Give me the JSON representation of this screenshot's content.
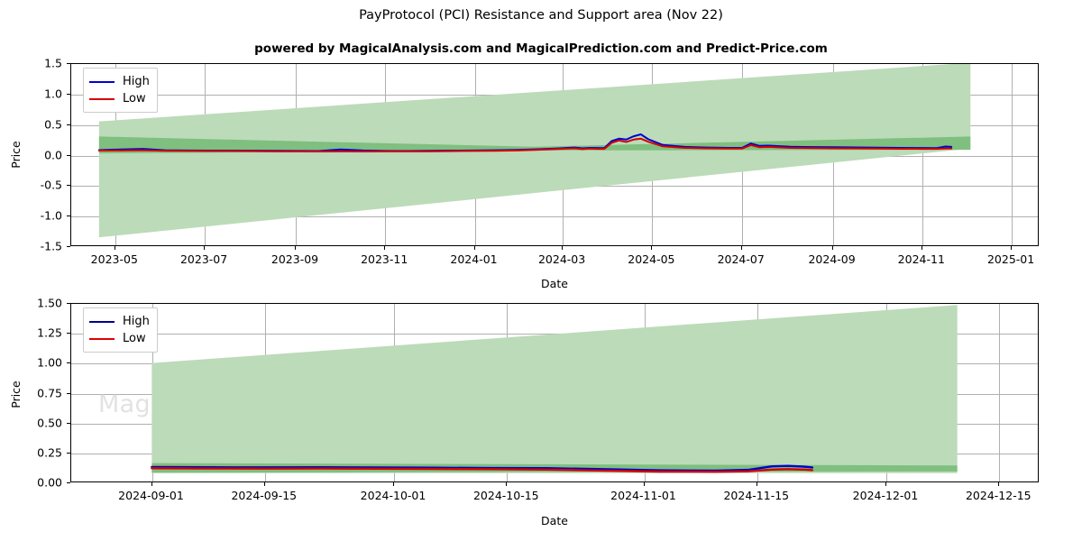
{
  "header": {
    "title": "PayProtocol (PCI) Resistance and Support area (Nov 22)",
    "subtitle": "powered by MagicalAnalysis.com and MagicalPrediction.com and Predict-Price.com"
  },
  "watermarks": {
    "analysis": "MagicalAnalysis.com",
    "prediction": "MagicalPrediction.com"
  },
  "colors": {
    "high_line": "#0000cd",
    "low_line": "#d40000",
    "band_outer": "#bcdbb9",
    "band_inner": "#7fbf7f",
    "grid": "#b0b0b0",
    "axis": "#000000"
  },
  "chart_data": [
    {
      "id": "upper",
      "type": "line",
      "title": "PayProtocol (PCI) Resistance and Support area (Nov 22)",
      "xlabel": "Date",
      "ylabel": "Price",
      "grid": true,
      "legend_position": "upper left",
      "xlim": [
        "2023-04-01",
        "2025-01-20"
      ],
      "ylim": [
        -1.5,
        1.5
      ],
      "xticks": [
        "2023-05",
        "2023-07",
        "2023-09",
        "2023-11",
        "2024-01",
        "2024-03",
        "2024-05",
        "2024-07",
        "2024-09",
        "2024-11",
        "2025-01"
      ],
      "yticks": [
        -1.5,
        -1.0,
        -0.5,
        0.0,
        0.5,
        1.0,
        1.5
      ],
      "series": [
        {
          "name": "High",
          "color": "#0000cd",
          "x": [
            "2023-04-20",
            "2023-05-05",
            "2023-05-20",
            "2023-06-04",
            "2023-06-19",
            "2023-07-04",
            "2023-07-19",
            "2023-08-03",
            "2023-08-18",
            "2023-09-02",
            "2023-09-17",
            "2023-10-02",
            "2023-10-17",
            "2023-11-01",
            "2023-11-16",
            "2023-12-01",
            "2023-12-16",
            "2023-12-31",
            "2024-01-15",
            "2024-01-30",
            "2024-02-14",
            "2024-02-29",
            "2024-03-10",
            "2024-03-15",
            "2024-03-20",
            "2024-03-25",
            "2024-03-30",
            "2024-04-04",
            "2024-04-09",
            "2024-04-14",
            "2024-04-19",
            "2024-04-24",
            "2024-04-29",
            "2024-05-09",
            "2024-05-24",
            "2024-06-08",
            "2024-06-23",
            "2024-07-02",
            "2024-07-08",
            "2024-07-14",
            "2024-07-20",
            "2024-08-04",
            "2024-08-19",
            "2024-09-03",
            "2024-09-18",
            "2024-10-03",
            "2024-10-18",
            "2024-11-02",
            "2024-11-12",
            "2024-11-18",
            "2024-11-22"
          ],
          "y": [
            0.075,
            0.085,
            0.095,
            0.072,
            0.07,
            0.068,
            0.067,
            0.065,
            0.063,
            0.062,
            0.06,
            0.086,
            0.07,
            0.062,
            0.061,
            0.063,
            0.066,
            0.07,
            0.072,
            0.078,
            0.088,
            0.105,
            0.118,
            0.105,
            0.112,
            0.11,
            0.108,
            0.225,
            0.265,
            0.25,
            0.305,
            0.335,
            0.255,
            0.16,
            0.128,
            0.118,
            0.112,
            0.112,
            0.185,
            0.145,
            0.15,
            0.13,
            0.125,
            0.122,
            0.12,
            0.115,
            0.112,
            0.11,
            0.108,
            0.135,
            0.128
          ]
        },
        {
          "name": "Low",
          "color": "#d40000",
          "x": [
            "2023-04-20",
            "2023-05-05",
            "2023-05-20",
            "2023-06-04",
            "2023-06-19",
            "2023-07-04",
            "2023-07-19",
            "2023-08-03",
            "2023-08-18",
            "2023-09-02",
            "2023-09-17",
            "2023-10-02",
            "2023-10-17",
            "2023-11-01",
            "2023-11-16",
            "2023-12-01",
            "2023-12-16",
            "2023-12-31",
            "2024-01-15",
            "2024-01-30",
            "2024-02-14",
            "2024-02-29",
            "2024-03-10",
            "2024-03-15",
            "2024-03-20",
            "2024-03-25",
            "2024-03-30",
            "2024-04-04",
            "2024-04-09",
            "2024-04-14",
            "2024-04-19",
            "2024-04-24",
            "2024-04-29",
            "2024-05-09",
            "2024-05-24",
            "2024-06-08",
            "2024-06-23",
            "2024-07-02",
            "2024-07-08",
            "2024-07-14",
            "2024-07-20",
            "2024-08-04",
            "2024-08-19",
            "2024-09-03",
            "2024-09-18",
            "2024-10-03",
            "2024-10-18",
            "2024-11-02",
            "2024-11-12",
            "2024-11-18",
            "2024-11-22"
          ],
          "y": [
            0.068,
            0.07,
            0.072,
            0.064,
            0.062,
            0.06,
            0.059,
            0.057,
            0.055,
            0.054,
            0.052,
            0.055,
            0.052,
            0.054,
            0.053,
            0.055,
            0.058,
            0.062,
            0.064,
            0.07,
            0.08,
            0.095,
            0.105,
            0.092,
            0.1,
            0.096,
            0.094,
            0.195,
            0.235,
            0.21,
            0.25,
            0.265,
            0.215,
            0.138,
            0.112,
            0.105,
            0.1,
            0.1,
            0.158,
            0.122,
            0.128,
            0.112,
            0.108,
            0.105,
            0.104,
            0.1,
            0.098,
            0.096,
            0.094,
            0.102,
            0.104
          ]
        }
      ],
      "bands": [
        {
          "name": "outer-resistance-support",
          "color": "#bcdbb9",
          "x_start": "2023-04-20",
          "x_end": "2024-12-05",
          "upper_start": 0.55,
          "upper_end": 1.52,
          "lower_start": -1.37,
          "lower_end": 0.1
        },
        {
          "name": "inner-resistance-support",
          "color": "#7fbf7f",
          "x_start": "2023-04-20",
          "x_end": "2024-12-05",
          "upper_start": 0.3,
          "upper_mid": 0.13,
          "upper_end": 0.3,
          "lower_start": 0.02,
          "lower_mid": 0.07,
          "lower_end": 0.08
        }
      ]
    },
    {
      "id": "lower",
      "type": "line",
      "xlabel": "Date",
      "ylabel": "Price",
      "grid": true,
      "legend_position": "upper left",
      "xlim": [
        "2024-08-22",
        "2024-12-20"
      ],
      "ylim": [
        0.0,
        1.5
      ],
      "xticks": [
        "2024-09-01",
        "2024-09-15",
        "2024-10-01",
        "2024-10-15",
        "2024-11-01",
        "2024-11-15",
        "2024-12-01",
        "2024-12-15"
      ],
      "yticks": [
        0.0,
        0.25,
        0.5,
        0.75,
        1.0,
        1.25,
        1.5
      ],
      "series": [
        {
          "name": "High",
          "color": "#0000cd",
          "x": [
            "2024-09-01",
            "2024-09-08",
            "2024-09-15",
            "2024-09-22",
            "2024-09-29",
            "2024-10-06",
            "2024-10-13",
            "2024-10-20",
            "2024-10-27",
            "2024-11-03",
            "2024-11-10",
            "2024-11-14",
            "2024-11-17",
            "2024-11-19",
            "2024-11-21",
            "2024-11-22"
          ],
          "y": [
            0.122,
            0.12,
            0.119,
            0.12,
            0.118,
            0.116,
            0.114,
            0.112,
            0.104,
            0.094,
            0.092,
            0.098,
            0.128,
            0.132,
            0.125,
            0.118
          ]
        },
        {
          "name": "Low",
          "color": "#d40000",
          "x": [
            "2024-09-01",
            "2024-09-08",
            "2024-09-15",
            "2024-09-22",
            "2024-09-29",
            "2024-10-06",
            "2024-10-13",
            "2024-10-20",
            "2024-10-27",
            "2024-11-03",
            "2024-11-10",
            "2024-11-14",
            "2024-11-17",
            "2024-11-19",
            "2024-11-21",
            "2024-11-22"
          ],
          "y": [
            0.112,
            0.11,
            0.109,
            0.11,
            0.108,
            0.106,
            0.104,
            0.1,
            0.092,
            0.084,
            0.082,
            0.086,
            0.1,
            0.104,
            0.1,
            0.096
          ]
        }
      ],
      "bands": [
        {
          "name": "outer-resistance-support",
          "color": "#bcdbb9",
          "x_start": "2024-09-01",
          "x_end": "2024-12-10",
          "upper_start": 1.0,
          "upper_end": 1.49,
          "lower_start": 0.07,
          "lower_end": 0.07
        },
        {
          "name": "inner-resistance-support",
          "color": "#7fbf7f",
          "x_start": "2024-09-01",
          "x_end": "2024-12-10",
          "upper_start": 0.155,
          "upper_end": 0.135,
          "lower_start": 0.075,
          "lower_end": 0.085
        }
      ]
    }
  ]
}
